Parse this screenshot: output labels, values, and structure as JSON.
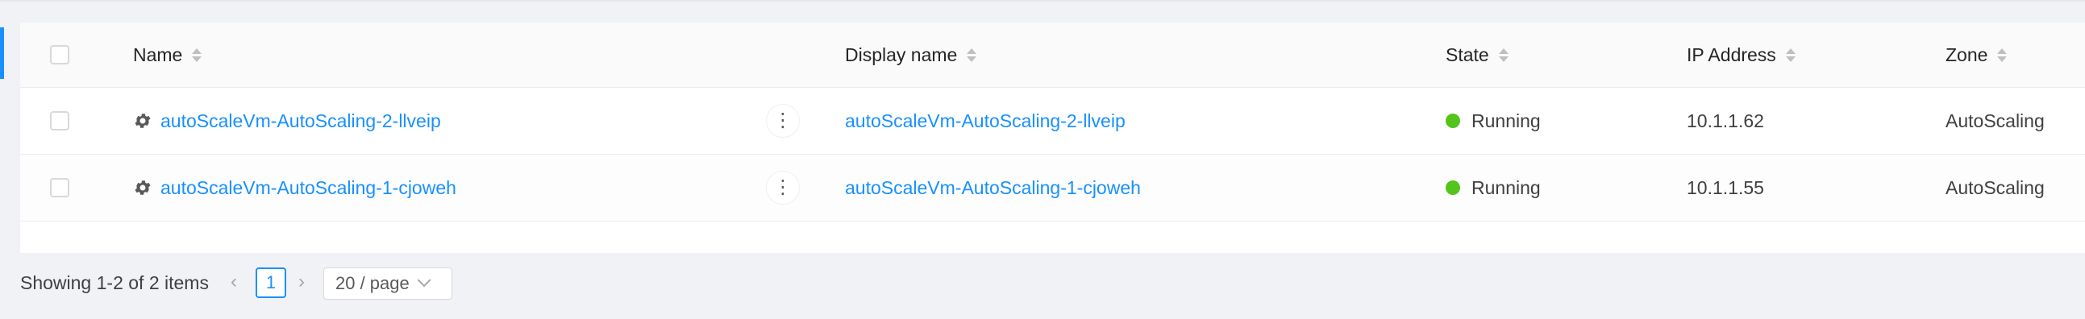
{
  "table": {
    "columns": [
      {
        "key": "name",
        "label": "Name"
      },
      {
        "key": "display_name",
        "label": "Display name"
      },
      {
        "key": "state",
        "label": "State"
      },
      {
        "key": "ip_address",
        "label": "IP Address"
      },
      {
        "key": "zone",
        "label": "Zone"
      }
    ],
    "rows": [
      {
        "name": "autoScaleVm-AutoScaling-2-llveip",
        "display_name": "autoScaleVm-AutoScaling-2-llveip",
        "state": "Running",
        "ip_address": "10.1.1.62",
        "zone": "AutoScaling"
      },
      {
        "name": "autoScaleVm-AutoScaling-1-cjoweh",
        "display_name": "autoScaleVm-AutoScaling-1-cjoweh",
        "state": "Running",
        "ip_address": "10.1.1.55",
        "zone": "AutoScaling"
      }
    ],
    "row_actions_glyph": "⋮",
    "vm_icon": "gear-icon",
    "status_color": "#52c41a",
    "link_color": "#1890ff"
  },
  "pagination": {
    "total_text": "Showing 1-2 of 2 items",
    "prev_glyph": "‹",
    "next_glyph": "›",
    "current_page": "1",
    "page_size": "20 / page"
  }
}
